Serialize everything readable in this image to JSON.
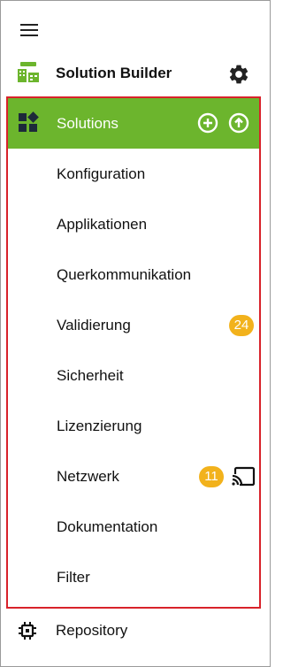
{
  "header": {
    "title": "Solution Builder",
    "logo_icon": "solution-builder-logo",
    "menu_icon": "hamburger-menu-icon",
    "settings_icon": "gear-icon"
  },
  "nav": {
    "active_color": "#6cb52d",
    "border_color": "#d8222a",
    "badge_color": "#f2b21c",
    "items": [
      {
        "label": "Solutions",
        "active": true,
        "icon": "dashboard-icon"
      },
      {
        "label": "Konfiguration"
      },
      {
        "label": "Applikationen"
      },
      {
        "label": "Querkommunikation"
      },
      {
        "label": "Validierung",
        "badge": "24"
      },
      {
        "label": "Sicherheit"
      },
      {
        "label": "Lizenzierung"
      },
      {
        "label": "Netzwerk",
        "badge": "11",
        "icon": "cast-icon"
      },
      {
        "label": "Dokumentation"
      },
      {
        "label": "Filter"
      }
    ],
    "solutions_actions": [
      "add-circle-icon",
      "upload-circle-icon"
    ]
  },
  "repository": {
    "label": "Repository",
    "icon": "chip-icon"
  }
}
